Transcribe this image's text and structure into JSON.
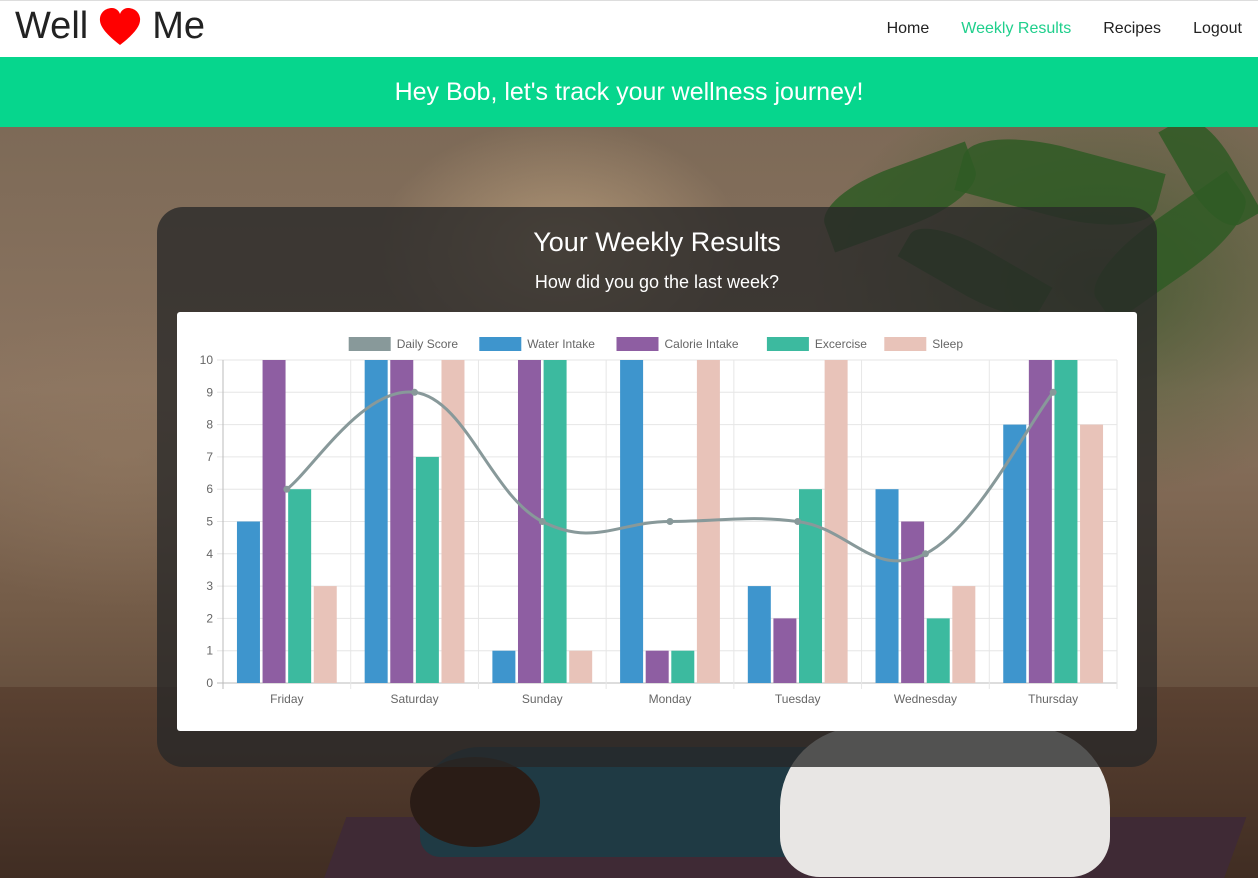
{
  "brand": {
    "left": "Well",
    "right": "Me",
    "icon": "heart-icon",
    "heart_color": "#ff0000"
  },
  "nav": {
    "items": [
      {
        "label": "Home",
        "active": false
      },
      {
        "label": "Weekly Results",
        "active": true
      },
      {
        "label": "Recipes",
        "active": false
      },
      {
        "label": "Logout",
        "active": false
      }
    ],
    "active_color": "#1fcf8c"
  },
  "banner": {
    "text": "Hey Bob, let's track your wellness journey!",
    "color": "#06d68d"
  },
  "card": {
    "title": "Your Weekly Results",
    "subtitle": "How did you go the last week?"
  },
  "chart_data": {
    "type": "bar",
    "categories": [
      "Friday",
      "Saturday",
      "Sunday",
      "Monday",
      "Tuesday",
      "Wednesday",
      "Thursday"
    ],
    "ylim": [
      0,
      10
    ],
    "yticks": [
      0,
      1,
      2,
      3,
      4,
      5,
      6,
      7,
      8,
      9,
      10
    ],
    "grid": true,
    "legend_position": "top",
    "line_series": {
      "name": "Daily Score",
      "color": "#88999a",
      "values": [
        6,
        9,
        5,
        5,
        5,
        4,
        9
      ]
    },
    "series": [
      {
        "name": "Water Intake",
        "color": "#3e95cd",
        "values": [
          5,
          10,
          1,
          10,
          3,
          6,
          8
        ]
      },
      {
        "name": "Calorie Intake",
        "color": "#8e5ea2",
        "values": [
          10,
          10,
          10,
          1,
          2,
          5,
          10
        ]
      },
      {
        "name": "Excercise",
        "color": "#3cba9f",
        "values": [
          6,
          7,
          10,
          1,
          6,
          2,
          10
        ]
      },
      {
        "name": "Sleep",
        "color": "#e8c3b9",
        "values": [
          3,
          10,
          1,
          10,
          10,
          3,
          8
        ]
      }
    ]
  }
}
